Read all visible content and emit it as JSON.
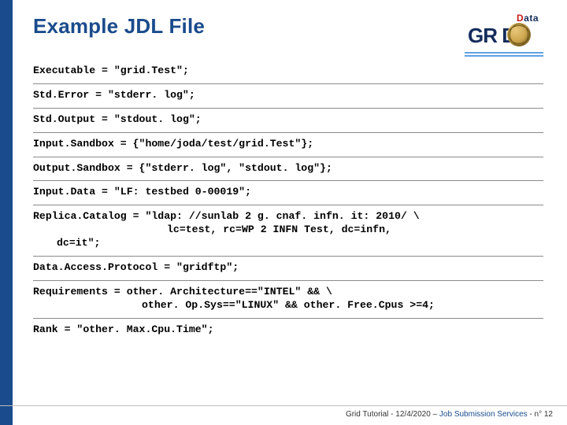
{
  "title": "Example JDL File",
  "logo": {
    "data_text": "Data",
    "grid_text": "GR  D"
  },
  "lines": {
    "l1": {
      "key": "Executable = ",
      "val": "\"grid.Test\";"
    },
    "l2": {
      "key": "Std.Error = ",
      "val": "\"stderr. log\";"
    },
    "l3": {
      "key": "Std.Output = ",
      "val": "\"stdout. log\";"
    },
    "l4": {
      "key": "Input.Sandbox = ",
      "val": "{\"home/joda/test/grid.Test\"};"
    },
    "l5": {
      "key": "Output.Sandbox = ",
      "val": "{\"stderr. log\", \"stdout. log\"};"
    },
    "l6": {
      "key": "Input.Data = ",
      "val": "\"LF: testbed 0-00019\";"
    },
    "l7": {
      "key": "Replica.Catalog = ",
      "val": "\"ldap: //sunlab 2 g. cnaf. infn. it: 2010/ \\",
      "cont1": "lc=test, rc=WP 2 INFN Test, dc=infn,",
      "cont2": "dc=it\";"
    },
    "l8": {
      "key": "Data.Access.Protocol = ",
      "val": "\"gridftp\";"
    },
    "l9": {
      "key": "Requirements = ",
      "val": "other. Architecture==\"INTEL\" && \\",
      "cont1": "other. Op.Sys==\"LINUX\" && other. Free.Cpus >=4;"
    },
    "l10": {
      "key": "Rank = ",
      "val": "\"other. Max.Cpu.Time\";"
    }
  },
  "footer": {
    "left": "Grid Tutorial",
    "date": "12/4/2020",
    "service": "Job Submission Services",
    "page": "n° 12",
    "sep": " - ",
    "dash": " – "
  }
}
